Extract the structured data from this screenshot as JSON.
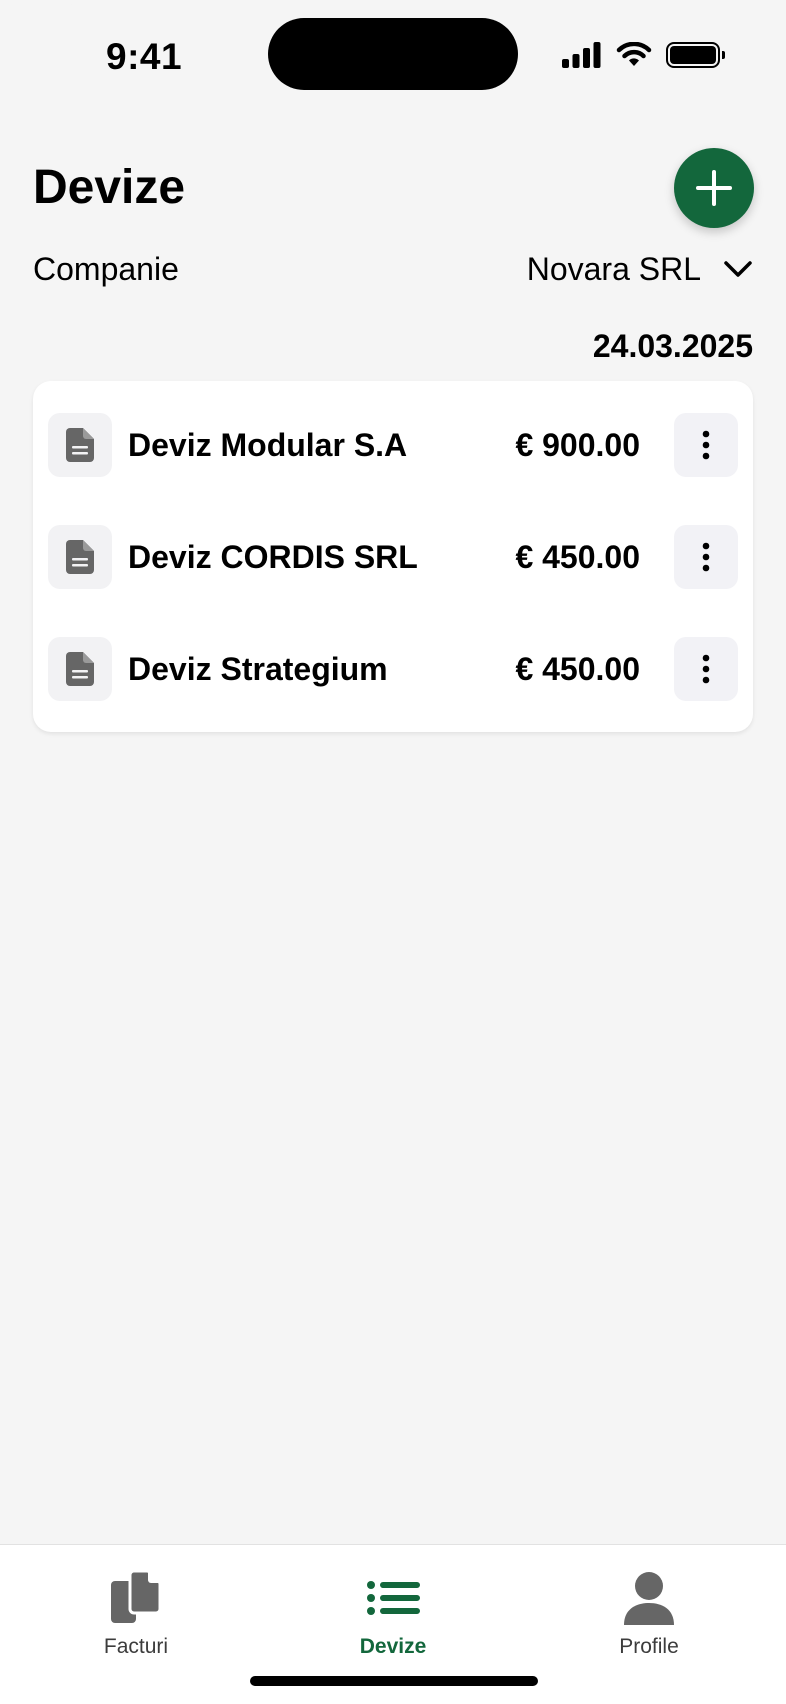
{
  "status_bar": {
    "time": "9:41"
  },
  "header": {
    "title": "Devize"
  },
  "company": {
    "label": "Companie",
    "selected": "Novara SRL"
  },
  "date": "24.03.2025",
  "items": [
    {
      "name": "Deviz Modular S.A",
      "amount": "€ 900.00"
    },
    {
      "name": "Deviz CORDIS SRL",
      "amount": "€ 450.00"
    },
    {
      "name": "Deviz Strategium",
      "amount": "€ 450.00"
    }
  ],
  "tabs": [
    {
      "label": "Facturi",
      "icon": "documents-icon",
      "active": false
    },
    {
      "label": "Devize",
      "icon": "list-icon",
      "active": true
    },
    {
      "label": "Profile",
      "icon": "person-icon",
      "active": false
    }
  ],
  "colors": {
    "accent": "#13673c",
    "background": "#f5f5f5",
    "icon_gray": "#666666"
  }
}
